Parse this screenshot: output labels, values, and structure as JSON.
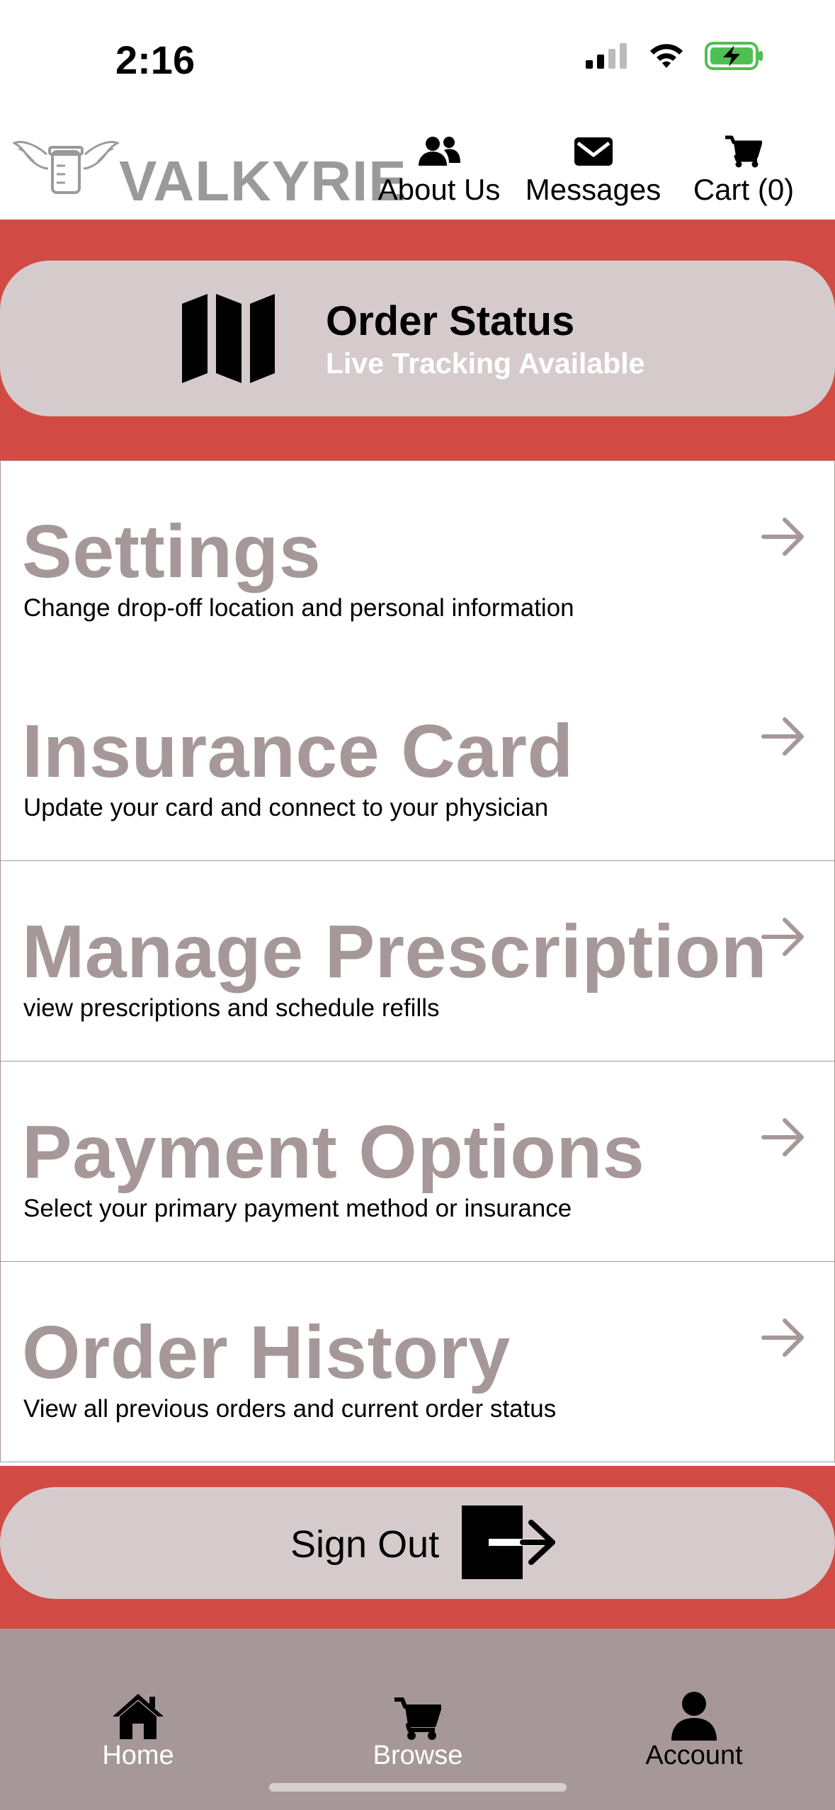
{
  "status_bar": {
    "time": "2:16"
  },
  "header": {
    "brand": "VALKYRIE",
    "nav": [
      {
        "label": "About Us",
        "icon": "users-icon"
      },
      {
        "label": "Messages",
        "icon": "envelope-icon"
      },
      {
        "label": "Cart (0)",
        "icon": "cart-icon"
      }
    ]
  },
  "order_status": {
    "title": "Order Status",
    "subtitle": "Live Tracking Available",
    "icon": "map-icon"
  },
  "menu": [
    {
      "title": "Settings",
      "description": "Change drop-off location and personal information"
    },
    {
      "title": "Insurance Card",
      "description": "Update your card and connect to your physician"
    },
    {
      "title": "Manage Prescription",
      "description": "view prescriptions and schedule refills"
    },
    {
      "title": "Payment Options",
      "description": "Select your primary payment method or insurance"
    },
    {
      "title": "Order History",
      "description": "View all previous orders and current order status"
    }
  ],
  "sign_out": {
    "label": "Sign Out",
    "icon": "sign-out-icon"
  },
  "tabbar": {
    "tabs": [
      {
        "label": "Home",
        "icon": "home-icon",
        "active": false
      },
      {
        "label": "Browse",
        "icon": "cart-icon",
        "active": false
      },
      {
        "label": "Account",
        "icon": "user-icon",
        "active": true
      }
    ]
  },
  "colors": {
    "accent_red": "#d14a43",
    "card_pink": "#d6cbcc",
    "muted_mauve": "#a69899"
  }
}
